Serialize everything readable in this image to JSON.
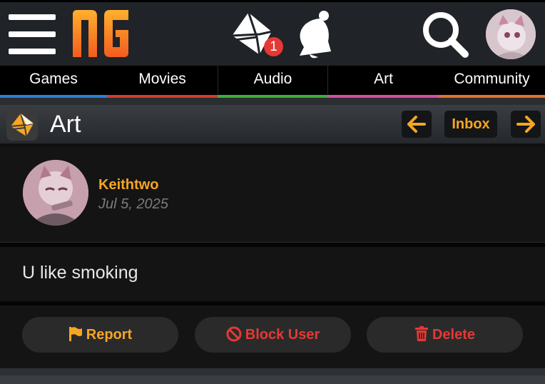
{
  "header": {
    "logo_text": "NG",
    "notification_count": "1"
  },
  "nav": {
    "items": [
      {
        "label": "Games",
        "color": "#2b7fd6"
      },
      {
        "label": "Movies",
        "color": "#d33a2f"
      },
      {
        "label": "Audio",
        "color": "#3fae3a"
      },
      {
        "label": "Art",
        "color": "#d64fa3"
      },
      {
        "label": "Community",
        "color": "#e0732a"
      }
    ]
  },
  "section": {
    "title": "Art",
    "inbox_label": "Inbox",
    "prev_icon": "arrow-left-icon",
    "next_icon": "arrow-right-icon"
  },
  "post": {
    "author": "Keithtwo",
    "date": "Jul 5, 2025",
    "body": "U like smoking"
  },
  "actions": {
    "report_label": "Report",
    "block_label": "Block User",
    "delete_label": "Delete"
  },
  "colors": {
    "accent": "#f5a623",
    "danger": "#e53935",
    "header_bg": "#202327"
  }
}
